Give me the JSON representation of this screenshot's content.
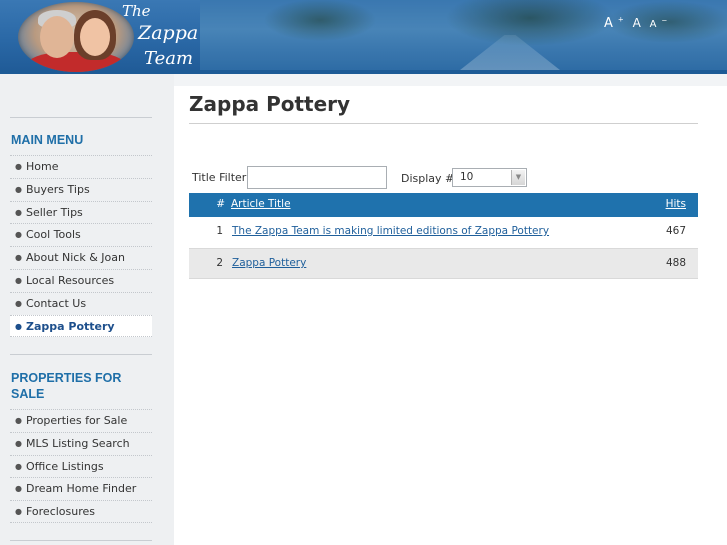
{
  "header": {
    "logo_line1": "The",
    "logo_line2": "Zappa",
    "logo_line3": "Team",
    "font_increase": "A",
    "font_increase_sup": "+",
    "font_reset": "A",
    "font_decrease": "A",
    "font_decrease_sup": "−"
  },
  "sidebar": {
    "main_menu_title": "MAIN MENU",
    "main_menu": [
      {
        "label": "Home"
      },
      {
        "label": "Buyers Tips"
      },
      {
        "label": "Seller Tips"
      },
      {
        "label": "Cool Tools"
      },
      {
        "label": "About Nick & Joan"
      },
      {
        "label": "Local Resources"
      },
      {
        "label": "Contact Us"
      },
      {
        "label": "Zappa Pottery",
        "active": true
      }
    ],
    "properties_title_line1": "PROPERTIES FOR",
    "properties_title_line2": "SALE",
    "properties_menu": [
      {
        "label": "Properties for Sale"
      },
      {
        "label": "MLS Listing Search"
      },
      {
        "label": "Office Listings"
      },
      {
        "label": "Dream Home Finder"
      },
      {
        "label": "Foreclosures"
      }
    ]
  },
  "main": {
    "page_title": "Zappa Pottery",
    "filter_label": "Title Filter",
    "filter_value": "",
    "display_label": "Display #",
    "display_value": "10",
    "table": {
      "col_num": "#",
      "col_title": "Article Title",
      "col_hits": "Hits",
      "rows": [
        {
          "num": "1",
          "title": "The Zappa Team is making limited editions of Zappa Pottery",
          "hits": "467"
        },
        {
          "num": "2",
          "title": "Zappa Pottery",
          "hits": "488"
        }
      ]
    }
  },
  "colors": {
    "accent": "#1f72ad",
    "menu_title": "#1f6fa8",
    "link": "#1f5f9b"
  }
}
